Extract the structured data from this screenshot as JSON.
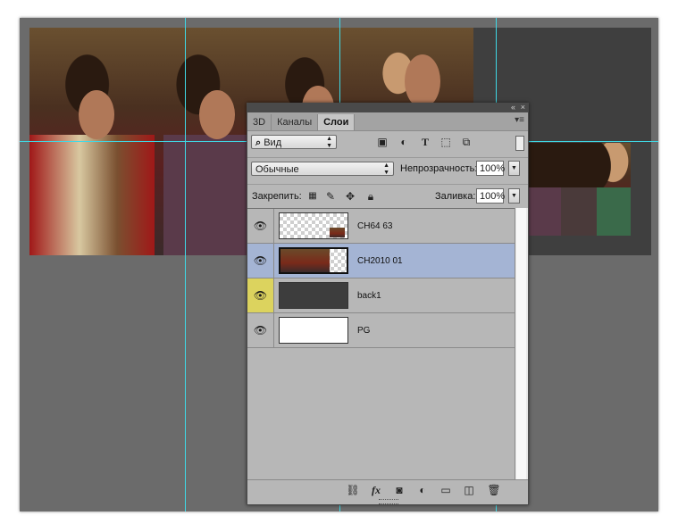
{
  "panel": {
    "collapse_glyph": "«",
    "close_glyph": "×",
    "tabs": [
      {
        "label": "3D"
      },
      {
        "label": "Каналы"
      },
      {
        "label": "Слои"
      }
    ],
    "filter": {
      "label": "Вид",
      "icon": "search-icon"
    },
    "blend_mode": "Обычные",
    "opacity_label": "Непрозрачность:",
    "opacity_value": "100%",
    "lock_label": "Закрепить:",
    "fill_label": "Заливка:",
    "fill_value": "100%",
    "layers": [
      {
        "name": "CH64 63",
        "visible": true
      },
      {
        "name": "CH2010 01",
        "visible": true,
        "selected": true
      },
      {
        "name": "back1",
        "visible": true
      },
      {
        "name": "PG",
        "visible": true
      }
    ],
    "footer_icons": [
      "link-icon",
      "fx-icon",
      "mask-icon",
      "adjustment-icon",
      "folder-icon",
      "new-layer-icon",
      "trash-icon"
    ]
  },
  "colors": {
    "guide": "#3fd9e6",
    "selected_layer": "#a4b4d4",
    "eye_highlight": "#dcd35e",
    "workspace": "#6b6b6b"
  }
}
